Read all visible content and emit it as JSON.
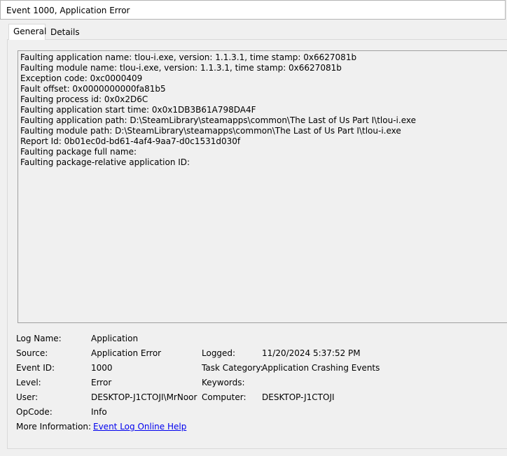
{
  "window": {
    "title": "Event 1000, Application Error"
  },
  "tabs": [
    {
      "label": "General"
    },
    {
      "label": "Details"
    }
  ],
  "description": {
    "lines": [
      "Faulting application name: tlou-i.exe, version: 1.1.3.1, time stamp: 0x6627081b",
      "Faulting module name: tlou-i.exe, version: 1.1.3.1, time stamp: 0x6627081b",
      "Exception code: 0xc0000409",
      "Fault offset: 0x0000000000fa81b5",
      "Faulting process id: 0x0x2D6C",
      "Faulting application start time: 0x0x1DB3B61A798DA4F",
      "Faulting application path: D:\\SteamLibrary\\steamapps\\common\\The Last of Us Part I\\tlou-i.exe",
      "Faulting module path: D:\\SteamLibrary\\steamapps\\common\\The Last of Us Part I\\tlou-i.exe",
      "Report Id: 0b01ec0d-bd61-4af4-9aa7-d0c1531d030f",
      "Faulting package full name: ",
      "Faulting package-relative application ID: "
    ]
  },
  "details": {
    "log_name": {
      "label": "Log Name:",
      "value": "Application"
    },
    "source": {
      "label": "Source:",
      "value": "Application Error"
    },
    "logged": {
      "label": "Logged:",
      "value": "11/20/2024 5:37:52 PM"
    },
    "event_id": {
      "label": "Event ID:",
      "value": "1000"
    },
    "task_category": {
      "label": "Task Category:",
      "value": "Application Crashing Events"
    },
    "level": {
      "label": "Level:",
      "value": "Error"
    },
    "keywords": {
      "label": "Keywords:",
      "value": ""
    },
    "user": {
      "label": "User:",
      "value": "DESKTOP-J1CTOJI\\MrNoor"
    },
    "computer": {
      "label": "Computer:",
      "value": "DESKTOP-J1CTOJI"
    },
    "opcode": {
      "label": "OpCode:",
      "value": "Info"
    },
    "more_info": {
      "label": "More Information:",
      "link": "Event Log Online Help"
    }
  }
}
